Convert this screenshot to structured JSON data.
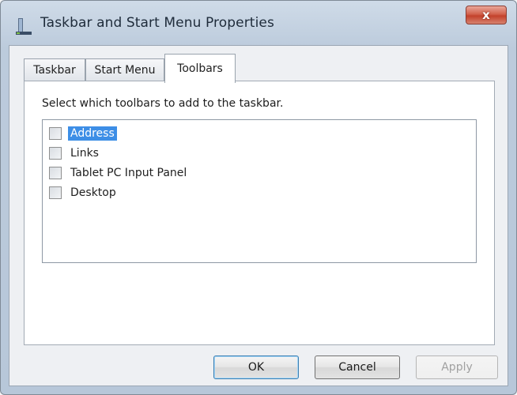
{
  "window": {
    "title": "Taskbar and Start Menu Properties",
    "close_label": "x"
  },
  "tabs": [
    {
      "label": "Taskbar",
      "active": false
    },
    {
      "label": "Start Menu",
      "active": false
    },
    {
      "label": "Toolbars",
      "active": true
    }
  ],
  "toolbars_tab": {
    "instruction": "Select which toolbars to add to the taskbar.",
    "items": [
      {
        "label": "Address",
        "checked": false,
        "selected": true
      },
      {
        "label": "Links",
        "checked": false,
        "selected": false
      },
      {
        "label": "Tablet PC Input Panel",
        "checked": false,
        "selected": false
      },
      {
        "label": "Desktop",
        "checked": false,
        "selected": false
      }
    ]
  },
  "buttons": {
    "ok": "OK",
    "cancel": "Cancel",
    "apply": "Apply"
  },
  "colors": {
    "selection": "#3d8ee6",
    "close_button": "#c3412b"
  }
}
